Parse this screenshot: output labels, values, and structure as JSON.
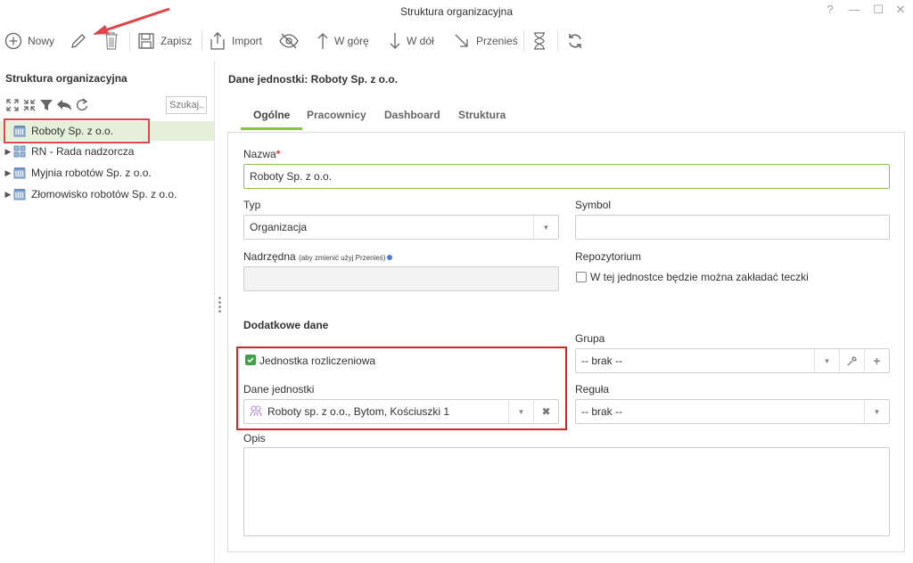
{
  "window": {
    "title": "Struktura organizacyjna",
    "controls": [
      "?",
      "—",
      "☐",
      "✕"
    ]
  },
  "toolbar": {
    "new_label": "Nowy",
    "save_label": "Zapisz",
    "import_label": "Import",
    "up_label": "W górę",
    "down_label": "W dół",
    "move_label": "Przenieś"
  },
  "left_panel": {
    "title": "Struktura organizacyjna",
    "search_placeholder": "Szukaj...",
    "tree": [
      {
        "label": "Roboty Sp. z o.o.",
        "selected": true,
        "expandable": false,
        "icon": "building-icon"
      },
      {
        "label": "RN - Rada nadzorcza",
        "selected": false,
        "expandable": true,
        "icon": "org-chart-icon"
      },
      {
        "label": "Myjnia robotów Sp. z o.o.",
        "selected": false,
        "expandable": true,
        "icon": "building-icon"
      },
      {
        "label": "Złomowisko robotów Sp. z o.o.",
        "selected": false,
        "expandable": true,
        "icon": "building-icon"
      }
    ]
  },
  "detail": {
    "title": "Dane jednostki: Roboty Sp. z o.o.",
    "tabs": [
      {
        "label": "Ogólne",
        "active": true
      },
      {
        "label": "Pracownicy",
        "active": false
      },
      {
        "label": "Dashboard",
        "active": false
      },
      {
        "label": "Struktura",
        "active": false
      }
    ],
    "form": {
      "name_label": "Nazwa",
      "name_value": "Roboty Sp. z o.o.",
      "type_label": "Typ",
      "type_value": "Organizacja",
      "symbol_label": "Symbol",
      "symbol_value": "",
      "parent_label": "Nadrzędna",
      "parent_hint": "(aby zmienić użyj Przenieś)",
      "parent_value": "",
      "repo_label": "Repozytorium",
      "repo_checkbox_label": "W tej jednostce będzie można zakładać teczki",
      "repo_checked": false,
      "extra_section": "Dodatkowe dane",
      "settlement_label": "Jednostka rozliczeniowa",
      "settlement_checked": true,
      "unit_data_label": "Dane jednostki",
      "unit_data_value": "Roboty sp. z o.o., Bytom, Kościuszki 1",
      "group_label": "Grupa",
      "group_value": "-- brak --",
      "rule_label": "Reguła",
      "rule_value": "-- brak --",
      "desc_label": "Opis",
      "desc_value": ""
    }
  },
  "colors": {
    "accent_green": "#8bc34a",
    "selected_row": "#e4f0d9",
    "annotation_red": "#d9222a",
    "required_star": "#e53935"
  }
}
